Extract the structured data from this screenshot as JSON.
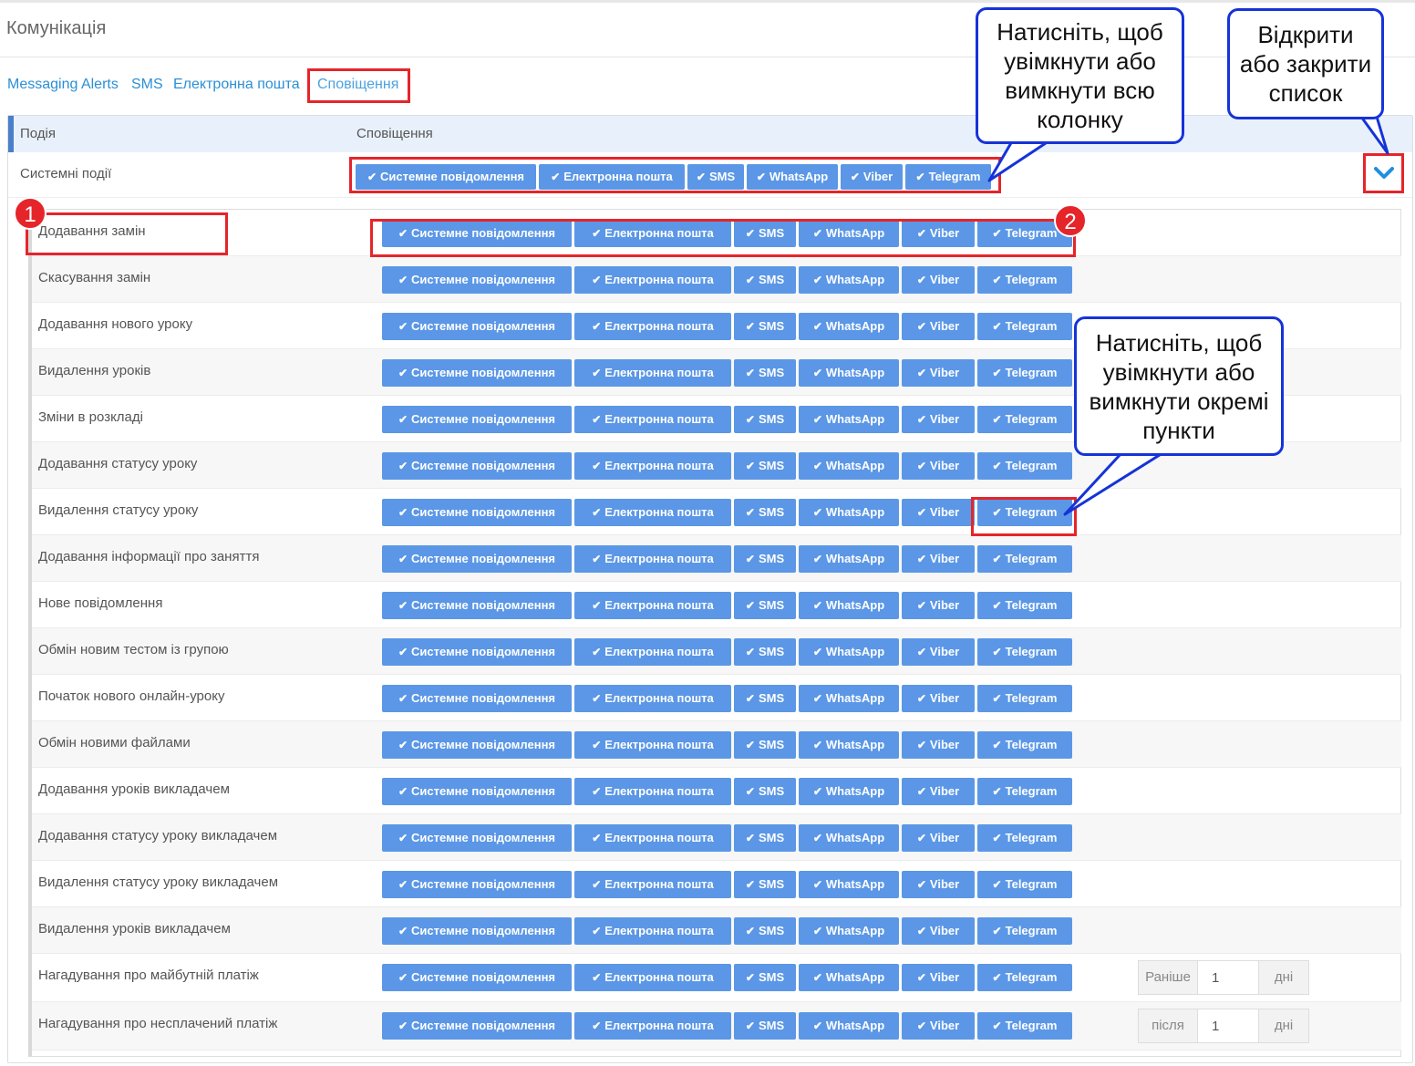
{
  "page": {
    "title": "Комунікація"
  },
  "tabs": [
    {
      "label": "Messaging Alerts"
    },
    {
      "label": "SMS"
    },
    {
      "label": "Електронна пошта"
    },
    {
      "label": "Сповіщення"
    }
  ],
  "table": {
    "col_event": "Подія",
    "col_notifications": "Сповіщення"
  },
  "system_events": {
    "label": "Системні події"
  },
  "channels": [
    "Системне повідомлення",
    "Електронна пошта",
    "SMS",
    "WhatsApp",
    "Viber",
    "Telegram"
  ],
  "channels_enabled": [
    true,
    true,
    true,
    true,
    true,
    true
  ],
  "events": [
    {
      "label": "Додавання замін"
    },
    {
      "label": "Скасування замін"
    },
    {
      "label": "Додавання нового уроку"
    },
    {
      "label": "Видалення уроків"
    },
    {
      "label": "Зміни в розкладі"
    },
    {
      "label": "Додавання статусу уроку"
    },
    {
      "label": "Видалення статусу уроку"
    },
    {
      "label": "Додавання інформації про заняття"
    },
    {
      "label": "Нове повідомлення"
    },
    {
      "label": "Обмін новим тестом із групою"
    },
    {
      "label": "Початок нового онлайн-уроку"
    },
    {
      "label": "Обмін новими файлами"
    },
    {
      "label": "Додавання уроків викладачем"
    },
    {
      "label": "Додавання статусу уроку викладачем"
    },
    {
      "label": "Видалення статусу уроку викладачем"
    },
    {
      "label": "Видалення уроків викладачем"
    },
    {
      "label": "Нагадування про майбутній платіж",
      "days": {
        "prefix": "Раніше",
        "value": "1",
        "suffix": "дні"
      }
    },
    {
      "label": "Нагадування про несплачений платіж",
      "days": {
        "prefix": "після",
        "value": "1",
        "suffix": "дні"
      }
    }
  ],
  "annotations": {
    "marker_1": "1",
    "marker_2": "2",
    "callout_column": "Натисніть, щоб увімкнути або вимкнути всю колонку",
    "callout_toggle_list": "Відкрити або закрити список",
    "callout_items": "Натисніть, щоб увімкнути або вимкнути окремі пункти"
  },
  "colors": {
    "accent": "#5b97e6",
    "highlight": "#e5252a",
    "callout_border": "#1633d8",
    "link": "#2b8fd6"
  }
}
